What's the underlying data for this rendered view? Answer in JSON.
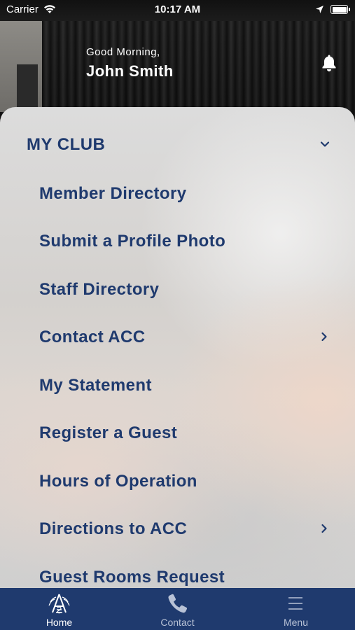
{
  "status_bar": {
    "carrier": "Carrier",
    "time": "10:17 AM"
  },
  "header": {
    "greeting": "Good Morning,",
    "user_name": "John Smith",
    "icons": [
      "bell-icon"
    ]
  },
  "menu": {
    "section_title": "MY CLUB",
    "section_expanded": true,
    "items": [
      {
        "label": "Member Directory",
        "has_submenu": false
      },
      {
        "label": "Submit a Profile Photo",
        "has_submenu": false
      },
      {
        "label": "Staff Directory",
        "has_submenu": false
      },
      {
        "label": "Contact ACC",
        "has_submenu": true
      },
      {
        "label": "My Statement",
        "has_submenu": false
      },
      {
        "label": "Register a Guest",
        "has_submenu": false
      },
      {
        "label": "Hours of Operation",
        "has_submenu": false
      },
      {
        "label": "Directions to ACC",
        "has_submenu": true
      },
      {
        "label": "Guest Rooms Request",
        "has_submenu": false
      }
    ]
  },
  "tab_bar": {
    "tabs": [
      {
        "label": "Home",
        "icon": "club-logo-icon",
        "active": true
      },
      {
        "label": "Contact",
        "icon": "phone-icon",
        "active": false
      },
      {
        "label": "Menu",
        "icon": "hamburger-menu-icon",
        "active": false
      }
    ]
  },
  "colors": {
    "brand_navy": "#1f3a6e",
    "tab_inactive": "#b8c2d6",
    "panel_bg": "#dcdcdc"
  }
}
